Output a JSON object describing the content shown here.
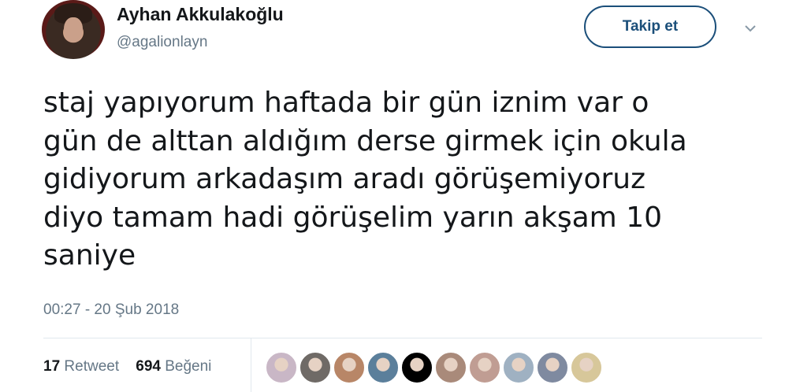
{
  "user": {
    "display_name": "Ayhan Akkulakoğlu",
    "handle": "@agalionlayn"
  },
  "follow_button": {
    "label": "Takip et"
  },
  "tweet": {
    "text": "staj yapıyorum haftada bir gün iznim var o\ngün de alttan aldığım derse girmek için okula\ngidiyorum arkadaşım aradı görüşemiyoruz\ndiyo tamam hadi görüşelim yarın akşam 10\nsaniye",
    "timestamp": "00:27 - 20 Şub 2018"
  },
  "stats": {
    "retweet_count": "17",
    "retweet_label": "Retweet",
    "like_count": "694",
    "like_label": "Beğeni"
  },
  "icons": {
    "menu": "chevron-down-icon"
  },
  "colors": {
    "accent": "#1b4f7a",
    "secondary_text": "#657786",
    "divider": "#e1e8ed"
  },
  "likers": [
    {
      "color": "#c9b7c6"
    },
    {
      "color": "#6f6a66"
    },
    {
      "color": "#b88667"
    },
    {
      "color": "#5b7f9b"
    },
    {
      "color": "#000000"
    },
    {
      "color": "#a98a7a"
    },
    {
      "color": "#c09d93"
    },
    {
      "color": "#9fb1c2"
    },
    {
      "color": "#7f8aa0"
    },
    {
      "color": "#d7c79a"
    }
  ]
}
